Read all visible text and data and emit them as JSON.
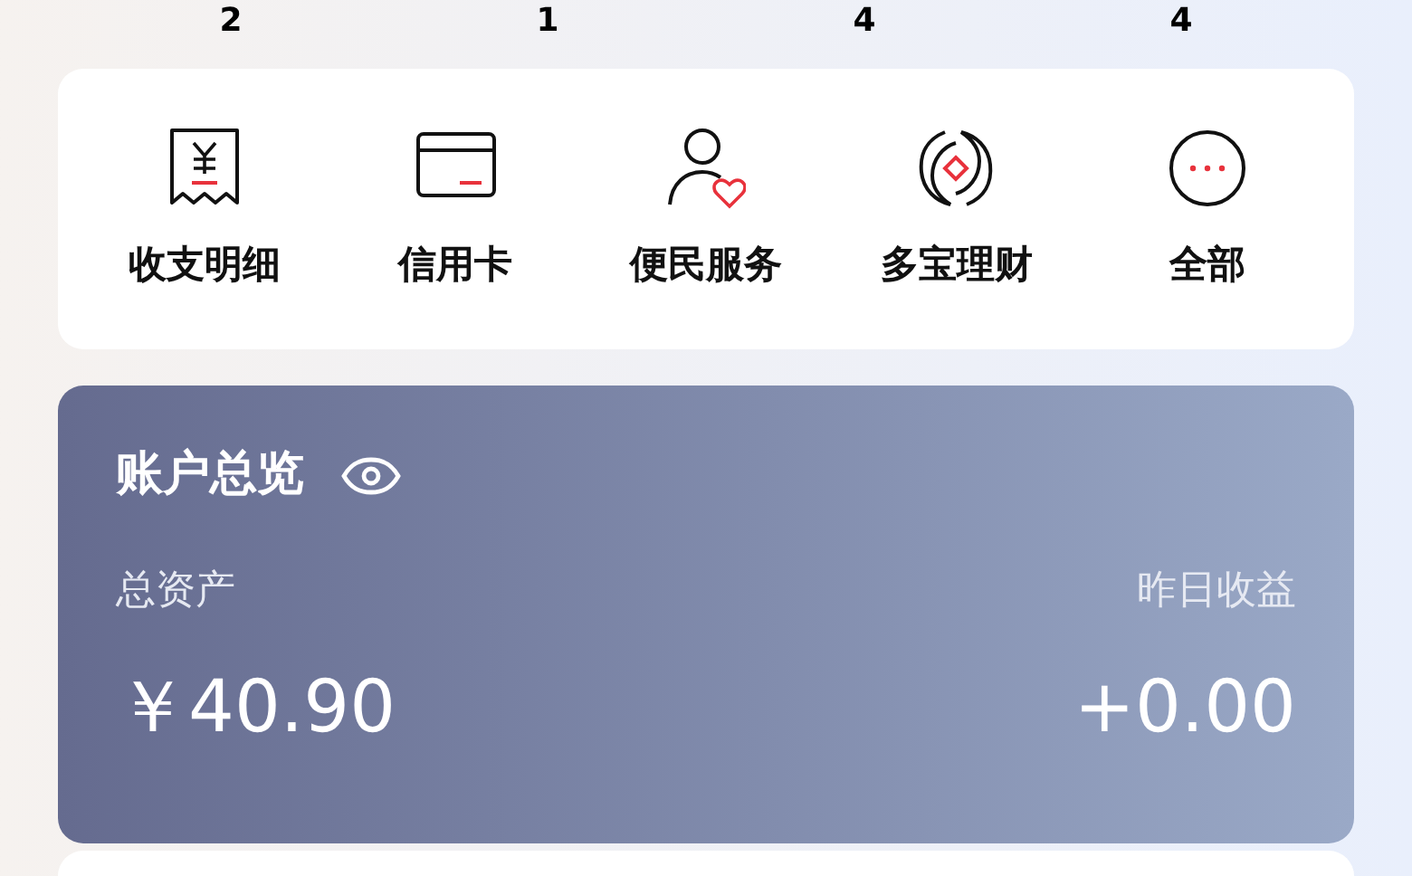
{
  "summary_counts": [
    "2",
    "1",
    "4",
    "4"
  ],
  "shortcuts": [
    {
      "label": "收支明细",
      "kind": "receipt"
    },
    {
      "label": "信用卡",
      "kind": "card"
    },
    {
      "label": "便民服务",
      "kind": "person"
    },
    {
      "label": "多宝理财",
      "kind": "finance"
    },
    {
      "label": "全部",
      "kind": "more"
    }
  ],
  "account": {
    "title": "账户总览",
    "total_label": "总资产",
    "total_value": "￥40.90",
    "yesterday_label": "昨日收益",
    "yesterday_value": "+0.00"
  }
}
